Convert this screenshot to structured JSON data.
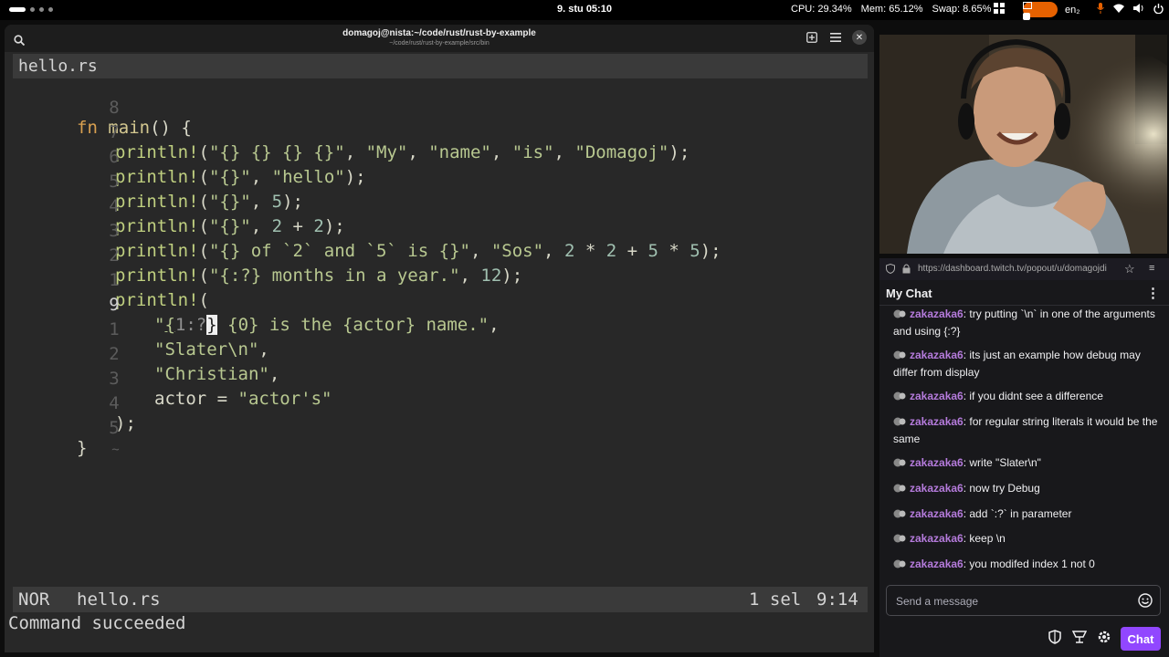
{
  "topbar": {
    "clock": "9. stu 05:10",
    "cpu": "CPU: 29.34%",
    "mem": "Mem: 65.12%",
    "swap": "Swap: 8.65%",
    "keyboard": "en₂"
  },
  "terminal": {
    "title": "domagoj@nista:~/code/rust/rust-by-example",
    "subtitle": "~/code/rust/rust-by-example/src/bin"
  },
  "editor": {
    "buffer_name": "hello.rs",
    "line_numbers": [
      "8",
      "7",
      "6",
      "5",
      "4",
      "3",
      "2",
      "1",
      "9",
      "1",
      "2",
      "3",
      "4",
      "5",
      "~"
    ],
    "lines": {
      "l0_kw": "fn",
      "l0_fn": "main",
      "l0_rest": "() {",
      "l1_mac": "println!",
      "l1_str1": "\"{} {} {} {}\"",
      "l1_str2": "\"My\"",
      "l1_str3": "\"name\"",
      "l1_str4": "\"is\"",
      "l1_str5": "\"Domagoj\"",
      "l2_str1": "\"{}\"",
      "l2_str2": "\"hello\"",
      "l3_num": "5",
      "l4_n1": "2",
      "l4_n2": "2",
      "l5_str1": "\"{} of `2` and `5` is {}\"",
      "l5_str2": "\"Sos\"",
      "l5_n1": "2",
      "l5_n2": "2",
      "l5_n3": "5",
      "l5_n4": "5",
      "l6_str1": "\"{:?} months in a year.\"",
      "l6_num": "12",
      "l8_q": "\"",
      "l8_brace": "{",
      "l8_mid": "1:?",
      "l8_close": "}",
      "l8_rest": " {0} is the {actor} name.\"",
      "l9_str": "\"Slater\\n\"",
      "l10_str": "\"Christian\"",
      "l11_id": "actor",
      "l11_str": "\"actor's\"",
      "l12": ");",
      "l13": "}"
    }
  },
  "statusline": {
    "mode": "NOR",
    "file": "hello.rs",
    "selections": "1 sel",
    "position": "9:14"
  },
  "command_output": "Command succeeded",
  "browser": {
    "url": "https://dashboard.twitch.tv/popout/u/domagojdi"
  },
  "chat": {
    "header": "My Chat",
    "messages": [
      {
        "user": "zakazaka6",
        "text": ": try putting `\\n` in one of the arguments and using {:?}"
      },
      {
        "user": "zakazaka6",
        "text": ": its just an example how debug may differ from display"
      },
      {
        "user": "zakazaka6",
        "text": ": if you didnt see a difference"
      },
      {
        "user": "zakazaka6",
        "text": ": for regular string literals it would be the same"
      },
      {
        "user": "zakazaka6",
        "text": ": write \"Slater\\n\""
      },
      {
        "user": "zakazaka6",
        "text": ": now try Debug"
      },
      {
        "user": "zakazaka6",
        "text": ": add `:?` in parameter"
      },
      {
        "user": "zakazaka6",
        "text": ": keep \\n"
      },
      {
        "user": "zakazaka6",
        "text": ": you modifed index 1 not 0"
      }
    ],
    "input_placeholder": "Send a message",
    "chat_button": "Chat"
  },
  "colors": {
    "twitch_purple": "#9147ff",
    "username": "#b57bdc",
    "record_orange": "#e66100"
  }
}
